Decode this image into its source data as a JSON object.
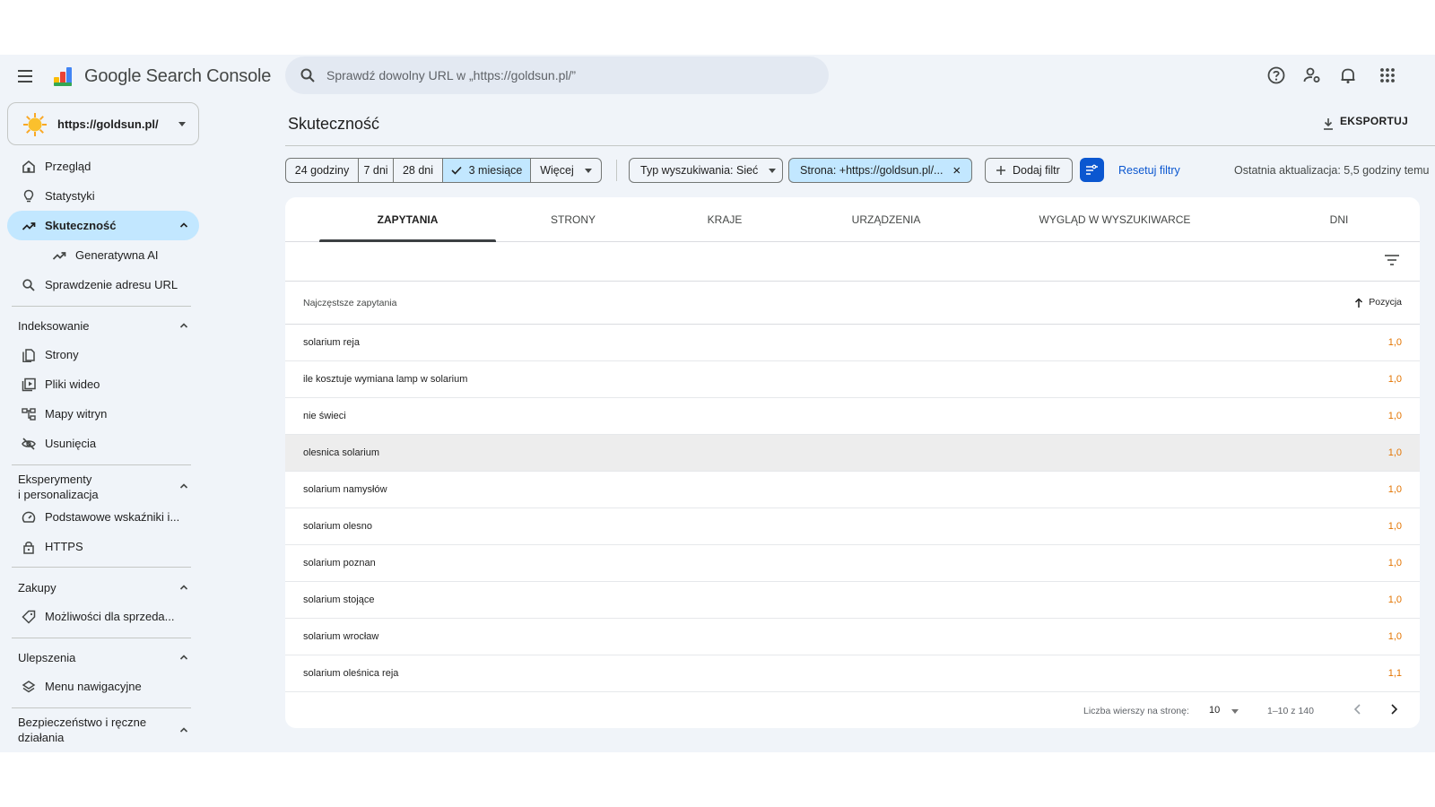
{
  "app": {
    "brand": "Google Search Console"
  },
  "search": {
    "placeholder": "Sprawdź dowolny URL w „https://goldsun.pl/”"
  },
  "property": {
    "label": "https://goldsun.pl/"
  },
  "sidebar": {
    "overview": "Przegląd",
    "stats": "Statystyki",
    "performance": "Skuteczność",
    "generative_ai": "Generatywna AI",
    "url_inspection": "Sprawdzenie adresu URL",
    "indexing": {
      "title": "Indeksowanie",
      "items": [
        "Strony",
        "Pliki wideo",
        "Mapy witryn",
        "Usunięcia"
      ]
    },
    "experiments": {
      "title_line1": "Eksperymenty",
      "title_line2": "i personalizacja",
      "items": [
        "Podstawowe wskaźniki i...",
        "HTTPS"
      ]
    },
    "shopping": {
      "title": "Zakupy",
      "items": [
        "Możliwości dla sprzeda..."
      ]
    },
    "enhancements": {
      "title": "Ulepszenia",
      "items": [
        "Menu nawigacyjne"
      ]
    },
    "security": {
      "title_line1": "Bezpieczeństwo i ręczne",
      "title_line2": "działania"
    }
  },
  "main": {
    "title": "Skuteczność",
    "export": "EKSPORTUJ",
    "date_ranges": [
      "24 godziny",
      "7 dni",
      "28 dni",
      "3 miesiące",
      "Więcej"
    ],
    "selected_range": "3 miesiące",
    "search_type": "Typ wyszukiwania: Sieć",
    "page_filter": "Strona: +https://goldsun.pl/...",
    "add_filter": "Dodaj filtr",
    "reset_filters": "Resetuj filtry",
    "last_update": "Ostatnia aktualizacja: 5,5 godziny temu"
  },
  "tabs": [
    "ZAPYTANIA",
    "STRONY",
    "KRAJE",
    "URZĄDZENIA",
    "WYGLĄD W WYSZUKIWARCE",
    "DNI"
  ],
  "table": {
    "col_query": "Najczęstsze zapytania",
    "col_position": "Pozycja",
    "rows": [
      {
        "query": "solarium reja",
        "position": "1,0"
      },
      {
        "query": "ile kosztuje wymiana lamp w solarium",
        "position": "1,0"
      },
      {
        "query": "nie świeci",
        "position": "1,0"
      },
      {
        "query": "olesnica solarium",
        "position": "1,0"
      },
      {
        "query": "solarium namysłów",
        "position": "1,0"
      },
      {
        "query": "solarium olesno",
        "position": "1,0"
      },
      {
        "query": "solarium poznan",
        "position": "1,0"
      },
      {
        "query": "solarium stojące",
        "position": "1,0"
      },
      {
        "query": "solarium wrocław",
        "position": "1,0"
      },
      {
        "query": "solarium oleśnica reja",
        "position": "1,1"
      }
    ]
  },
  "pagination": {
    "rows_per_page_label": "Liczba wierszy na stronę:",
    "rows_per_page": "10",
    "range": "1–10 z 140"
  },
  "colors": {
    "accent": "#0b57d0",
    "selected": "#c2e7ff",
    "position": "#e37400",
    "background": "#f0f4f9"
  }
}
